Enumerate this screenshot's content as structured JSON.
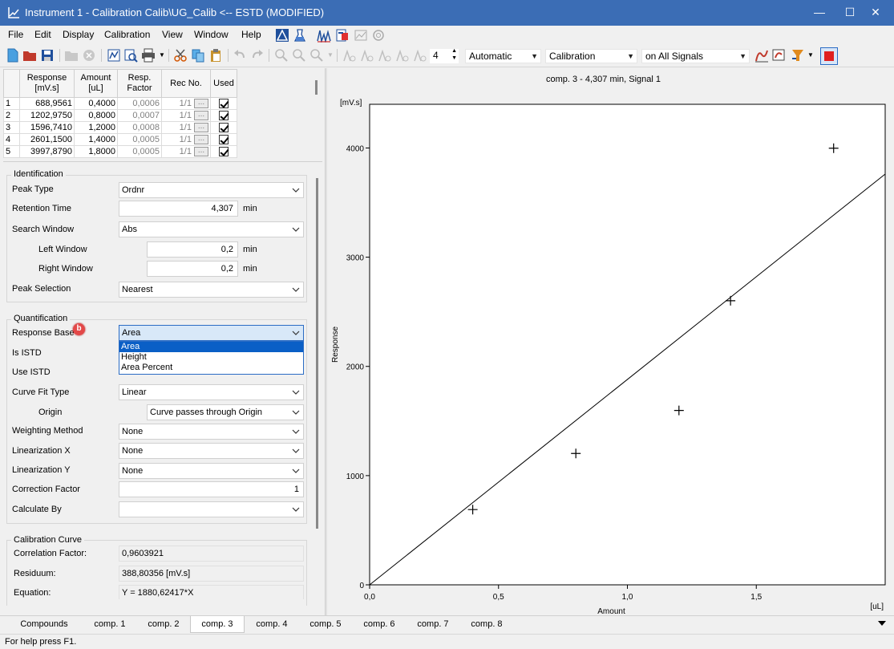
{
  "window": {
    "title": "Instrument 1 - Calibration Calib\\UG_Calib <-- ESTD (MODIFIED)",
    "minimize": "—",
    "maximize": "☐",
    "close": "✕"
  },
  "menu": [
    "File",
    "Edit",
    "Display",
    "Calibration",
    "View",
    "Window",
    "Help"
  ],
  "toolbar": {
    "spin_value": "4",
    "combo1": "Automatic",
    "combo2": "Calibration",
    "combo3": "on All Signals"
  },
  "grid": {
    "headers": [
      "",
      "Response\n[mV.s]",
      "Amount\n[uL]",
      "Resp.\nFactor",
      "Rec No.",
      "Used"
    ],
    "rows": [
      {
        "n": "1",
        "response": "688,9561",
        "amount": "0,4000",
        "factor": "0,0006",
        "rec": "1/1",
        "used": true
      },
      {
        "n": "2",
        "response": "1202,9750",
        "amount": "0,8000",
        "factor": "0,0007",
        "rec": "1/1",
        "used": true
      },
      {
        "n": "3",
        "response": "1596,7410",
        "amount": "1,2000",
        "factor": "0,0008",
        "rec": "1/1",
        "used": true
      },
      {
        "n": "4",
        "response": "2601,1500",
        "amount": "1,4000",
        "factor": "0,0005",
        "rec": "1/1",
        "used": true
      },
      {
        "n": "5",
        "response": "3997,8790",
        "amount": "1,8000",
        "factor": "0,0005",
        "rec": "1/1",
        "used": true
      }
    ],
    "ellipsis": "..."
  },
  "identification": {
    "title": "Identification",
    "peak_type_label": "Peak Type",
    "peak_type": "Ordnr",
    "retention_label": "Retention Time",
    "retention": "4,307",
    "retention_unit": "min",
    "search_window_label": "Search Window",
    "search_window": "Abs",
    "left_window_label": "Left Window",
    "left_window": "0,2",
    "left_unit": "min",
    "right_window_label": "Right Window",
    "right_window": "0,2",
    "right_unit": "min",
    "peak_selection_label": "Peak Selection",
    "peak_selection": "Nearest"
  },
  "quantification": {
    "title": "Quantification",
    "response_base_label": "Response Base",
    "response_base": "Area",
    "badge": "b",
    "dropdown_options": [
      "Area",
      "Height",
      "Area Percent"
    ],
    "is_istd_label": "Is ISTD",
    "use_istd_label": "Use ISTD",
    "curve_fit_label": "Curve Fit Type",
    "curve_fit": "Linear",
    "origin_label": "Origin",
    "origin": "Curve passes through Origin",
    "weighting_label": "Weighting Method",
    "weighting": "None",
    "lin_x_label": "Linearization X",
    "lin_x": "None",
    "lin_y_label": "Linearization Y",
    "lin_y": "None",
    "correction_label": "Correction Factor",
    "correction": "1",
    "calc_by_label": "Calculate By",
    "calc_by": ""
  },
  "calibration_curve": {
    "title": "Calibration Curve",
    "corr_label": "Correlation Factor:",
    "corr": "0,9603921",
    "resid_label": "Residuum:",
    "resid": "388,80356 [mV.s]",
    "eq_label": "Equation:",
    "eq": "Y = 1880,62417*X"
  },
  "chart_data": {
    "type": "scatter",
    "title": "comp. 3 - 4,307 min, Signal 1",
    "xlabel": "Amount",
    "ylabel": "Response",
    "xunit": "[uL]",
    "yunit": "[mV.s]",
    "xlim": [
      0,
      2.0
    ],
    "ylim": [
      0,
      4400
    ],
    "xticks": [
      0,
      0.5,
      1.0,
      1.5
    ],
    "xtick_labels": [
      "0,0",
      "0,5",
      "1,0",
      "1,5"
    ],
    "yticks": [
      0,
      1000,
      2000,
      3000,
      4000
    ],
    "ytick_labels": [
      "0",
      "1000",
      "2000",
      "3000",
      "4000"
    ],
    "points": [
      {
        "x": 0.4,
        "y": 688.9561
      },
      {
        "x": 0.8,
        "y": 1202.975
      },
      {
        "x": 1.2,
        "y": 1596.741
      },
      {
        "x": 1.4,
        "y": 2601.15
      },
      {
        "x": 1.8,
        "y": 3997.879
      }
    ],
    "fit_slope": 1880.62417,
    "grid": false
  },
  "tabs": [
    "Compounds",
    "comp. 1",
    "comp. 2",
    "comp. 3",
    "comp. 4",
    "comp. 5",
    "comp. 6",
    "comp. 7",
    "comp. 8"
  ],
  "active_tab": "comp. 3",
  "status": "For help press F1."
}
